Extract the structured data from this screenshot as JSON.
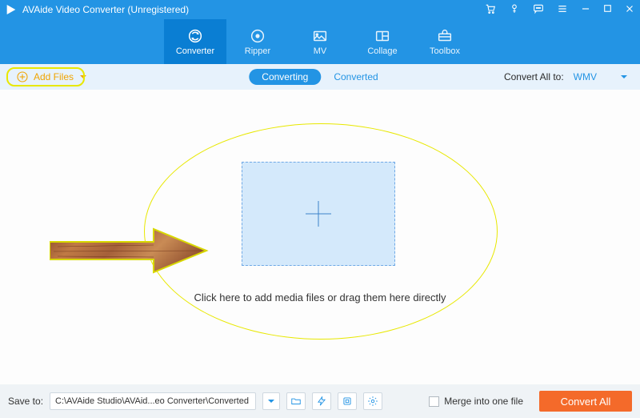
{
  "title": "AVAide Video Converter (Unregistered)",
  "nav": {
    "converter": "Converter",
    "ripper": "Ripper",
    "mv": "MV",
    "collage": "Collage",
    "toolbox": "Toolbox"
  },
  "toolbar": {
    "add_files": "Add Files",
    "subtab_converting": "Converting",
    "subtab_converted": "Converted",
    "convert_all_to_label": "Convert All to:",
    "convert_all_to_value": "WMV"
  },
  "main": {
    "drop_caption": "Click here to add media files or drag them here directly"
  },
  "footer": {
    "save_to_label": "Save to:",
    "save_to_path": "C:\\AVAide Studio\\AVAid...eo Converter\\Converted",
    "merge_label": "Merge into one file",
    "convert_all": "Convert All"
  },
  "icons": {
    "logo": "avaide-logo-icon",
    "cart": "cart-icon",
    "key": "key-icon",
    "feedback": "feedback-icon",
    "menu": "menu-icon",
    "minimize": "minimize-icon",
    "maximize": "maximize-icon",
    "close": "close-icon",
    "plus": "plus-icon",
    "folder": "folder-icon",
    "flash": "flash-icon",
    "gpu": "gpu-icon",
    "gear": "gear-icon",
    "checkbox": "checkbox-icon"
  },
  "colors": {
    "brand": "#2394e4",
    "brand_dark": "#0a7ed3",
    "accent": "#f46a2a",
    "highlight": "#e8e800",
    "dropzone_bg": "#d4e9fb"
  }
}
